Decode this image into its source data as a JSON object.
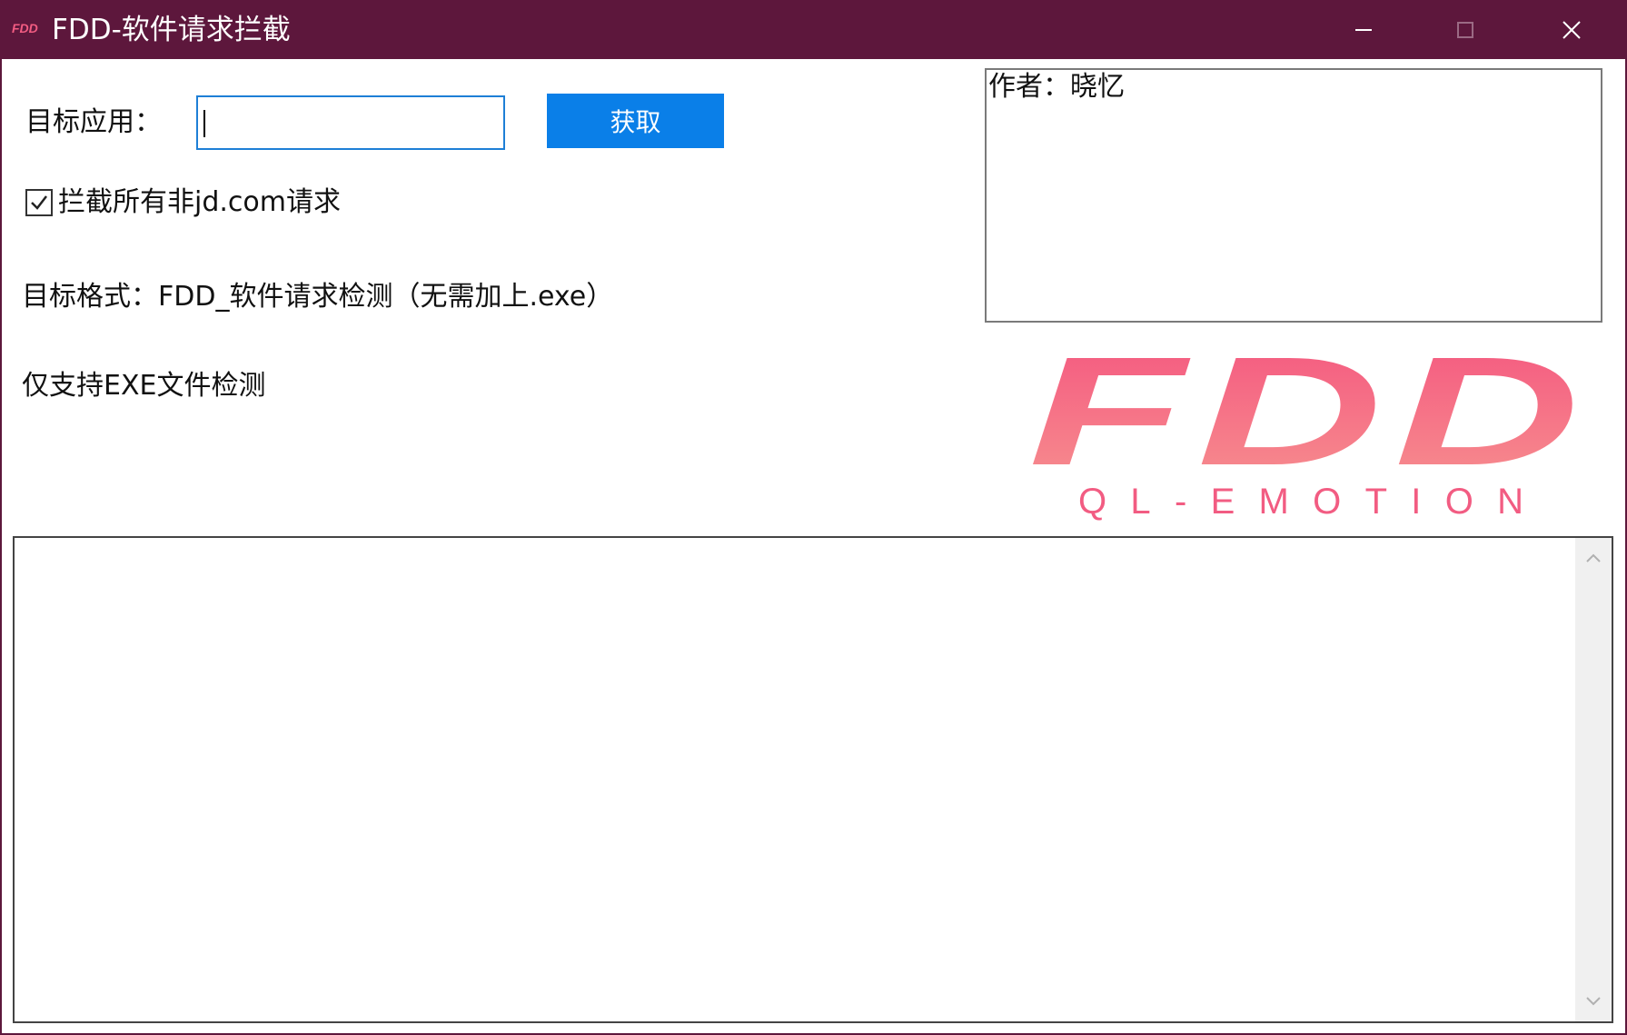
{
  "window": {
    "title": "FDD-软件请求拦截",
    "title_logo_text": "FDD",
    "titlebar_color": "#5d173c"
  },
  "controls": {
    "minimize_icon": "minimize-icon",
    "maximize_icon": "maximize-icon",
    "close_icon": "close-icon"
  },
  "form": {
    "target_label": "目标应用：",
    "target_value": "",
    "fetch_label": "获取",
    "block_checkbox_label": "拦截所有非jd.com请求",
    "block_checked": true,
    "format_hint": "目标格式：FDD_软件请求检测（无需加上.exe）",
    "support_hint": "仅支持EXE文件检测"
  },
  "author": {
    "text": "作者：晓忆"
  },
  "logo": {
    "main_text": "FDD",
    "sub_text": "QL-EMOTION",
    "color": "#f25c82"
  },
  "log": {
    "content": ""
  },
  "colors": {
    "accent": "#0a7fe8",
    "input_border": "#1e7fd6",
    "logo_pink": "#f25c82"
  }
}
